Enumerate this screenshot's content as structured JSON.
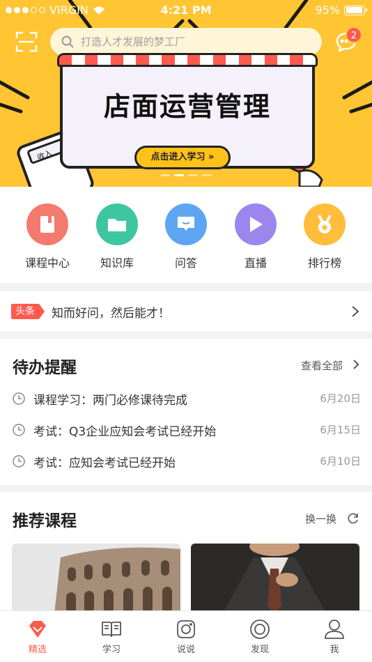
{
  "status_bar": {
    "carrier": "VIRGIN",
    "time": "4:21 PM",
    "battery": "95%",
    "battery_level": 0.95
  },
  "search": {
    "placeholder": "打造人才发展的梦工厂"
  },
  "messages": {
    "badge": "2"
  },
  "banner": {
    "title": "店面运营管理",
    "button": "点击进入学习 »",
    "page_count": 4,
    "active_page": 2
  },
  "quick_nav": [
    {
      "label": "课程中心",
      "icon": "book-icon",
      "color": "#f47a6e"
    },
    {
      "label": "知识库",
      "icon": "folder-icon",
      "color": "#3ec6a0"
    },
    {
      "label": "问答",
      "icon": "chat-icon",
      "color": "#5ea6f2"
    },
    {
      "label": "直播",
      "icon": "play-icon",
      "color": "#9c86ee"
    },
    {
      "label": "排行榜",
      "icon": "medal-icon",
      "color": "#ffbd3b"
    }
  ],
  "headline": {
    "tag": "头条",
    "text": "知而好问，然后能才！"
  },
  "todo": {
    "title": "待办提醒",
    "more": "查看全部",
    "items": [
      {
        "text": "课程学习：两门必修课待完成",
        "date": "6月20日"
      },
      {
        "text": "考试：Q3企业应知会考试已经开始",
        "date": "6月15日"
      },
      {
        "text": "考试：应知会考试已经开始",
        "date": "6月10日"
      }
    ]
  },
  "recommend": {
    "title": "推荐课程",
    "refresh": "换一换"
  },
  "tabbar": [
    {
      "label": "精选",
      "icon": "diamond-icon",
      "active": true
    },
    {
      "label": "学习",
      "icon": "open-book-icon"
    },
    {
      "label": "说说",
      "icon": "camera-icon"
    },
    {
      "label": "发现",
      "icon": "compass-icon"
    },
    {
      "label": "我",
      "icon": "person-icon"
    }
  ],
  "colors": {
    "accent": "#ff5a4e",
    "banner": "#ffc533"
  }
}
